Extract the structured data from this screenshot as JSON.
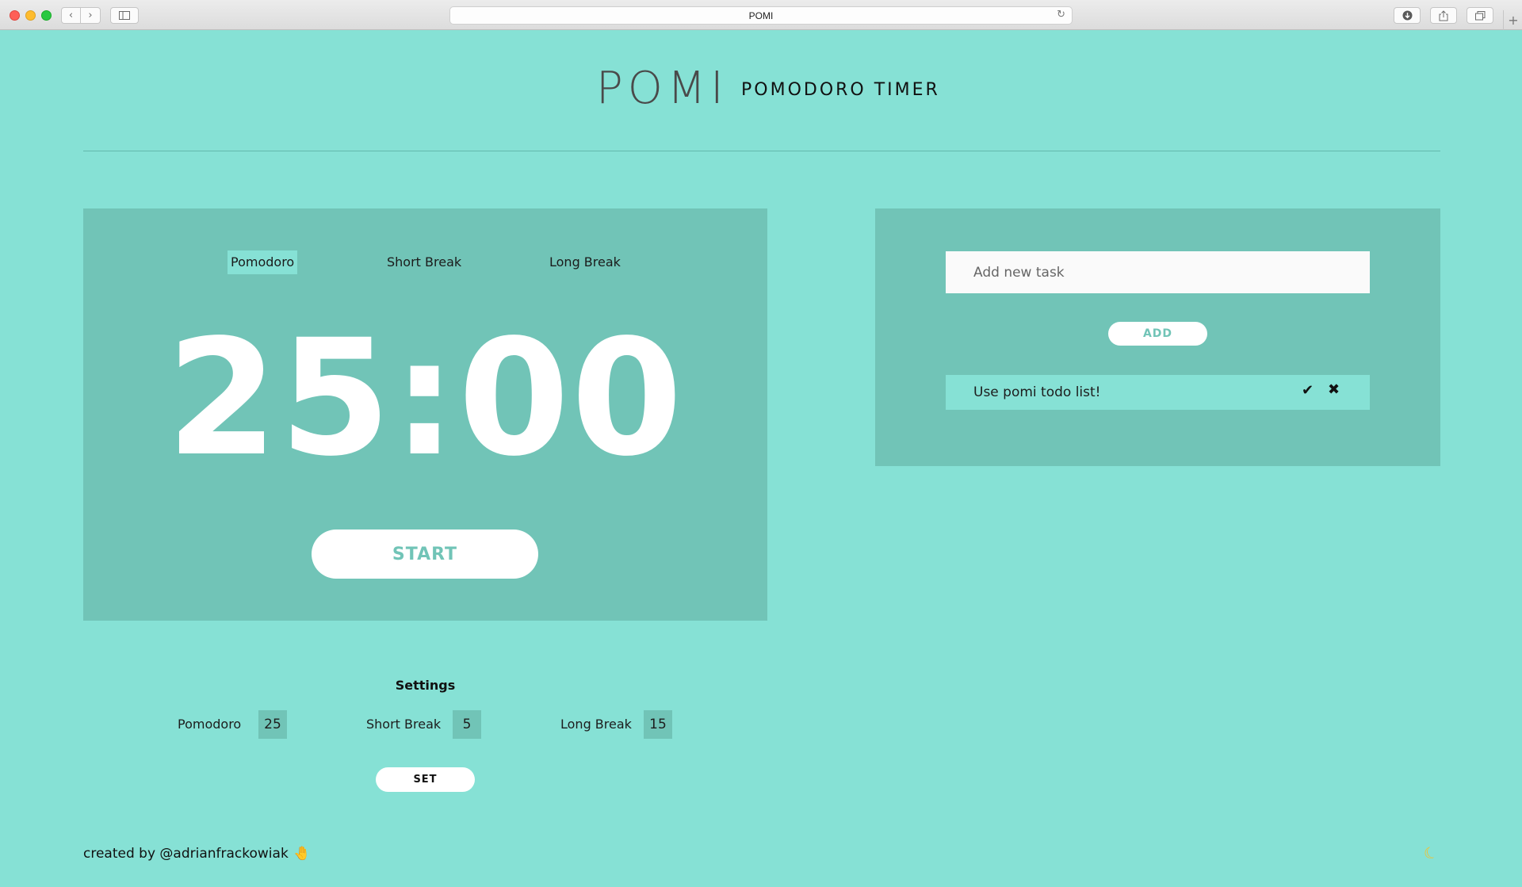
{
  "browser": {
    "url": "POMI",
    "icons": {
      "back": "chevron-left-icon",
      "forward": "chevron-right-icon",
      "sidebar": "sidebar-icon",
      "reload": "reload-icon",
      "download": "download-icon",
      "share": "share-icon",
      "tabs": "tabs-icon",
      "new_tab": "plus-icon"
    }
  },
  "header": {
    "logo": "POMI",
    "subtitle": "POMODORO TIMER"
  },
  "timer": {
    "tabs": [
      {
        "label": "Pomodoro",
        "active": true
      },
      {
        "label": "Short Break",
        "active": false
      },
      {
        "label": "Long Break",
        "active": false
      }
    ],
    "time": "25:00",
    "start_label": "START"
  },
  "settings": {
    "title": "Settings",
    "items": [
      {
        "label": "Pomodoro",
        "value": "25"
      },
      {
        "label": "Short Break",
        "value": "5"
      },
      {
        "label": "Long Break",
        "value": "15"
      }
    ],
    "set_label": "SET"
  },
  "todo": {
    "input_placeholder": "Add new task",
    "add_label": "ADD",
    "items": [
      {
        "text": "Use pomi todo list!"
      }
    ]
  },
  "footer": {
    "credit": "created by @adrianfrackowiak"
  },
  "colors": {
    "background": "#86e1d5",
    "card": "#71c4b7",
    "white": "#ffffff",
    "text": "#1d1d1d"
  }
}
